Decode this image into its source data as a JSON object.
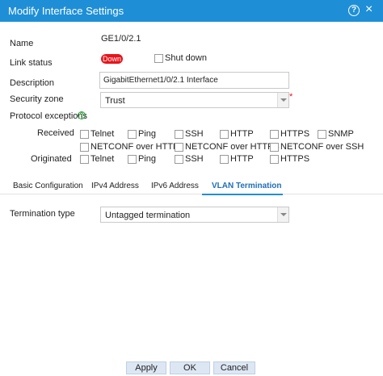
{
  "dialog": {
    "title": "Modify Interface Settings",
    "help_glyph": "?",
    "close_glyph": "×"
  },
  "form": {
    "name": {
      "label": "Name",
      "value": "GE1/0/2.1"
    },
    "link_status": {
      "label": "Link status",
      "badge": "Down",
      "badge_color": "#e8141b",
      "shutdown_label": "Shut down",
      "shutdown_checked": false
    },
    "description": {
      "label": "Description",
      "value": "GigabitEthernet1/0/2.1 Interface"
    },
    "security_zone": {
      "label": "Security zone",
      "value": "Trust",
      "required_mark": "*"
    },
    "protocol_exceptions": {
      "label": "Protocol exceptions",
      "help_glyph": "?"
    },
    "received": {
      "label": "Received",
      "row1": [
        "Telnet",
        "Ping",
        "SSH",
        "HTTP",
        "HTTPS",
        "SNMP"
      ],
      "row2": [
        "NETCONF over HTTP",
        "NETCONF over HTTPS",
        "NETCONF over SSH"
      ]
    },
    "originated": {
      "label": "Originated",
      "items": [
        "Telnet",
        "Ping",
        "SSH",
        "HTTP",
        "HTTPS"
      ]
    }
  },
  "tabs": [
    {
      "label": "Basic Configuration",
      "active": false
    },
    {
      "label": "IPv4 Address",
      "active": false
    },
    {
      "label": "IPv6 Address",
      "active": false
    },
    {
      "label": "VLAN Termination",
      "active": true
    }
  ],
  "vlan": {
    "termination_label": "Termination type",
    "termination_value": "Untagged termination"
  },
  "buttons": {
    "apply": "Apply",
    "ok": "OK",
    "cancel": "Cancel"
  },
  "colors": {
    "titlebar": "#1e8fd6",
    "accent": "#1e6fb8",
    "status_down": "#e8141b"
  }
}
